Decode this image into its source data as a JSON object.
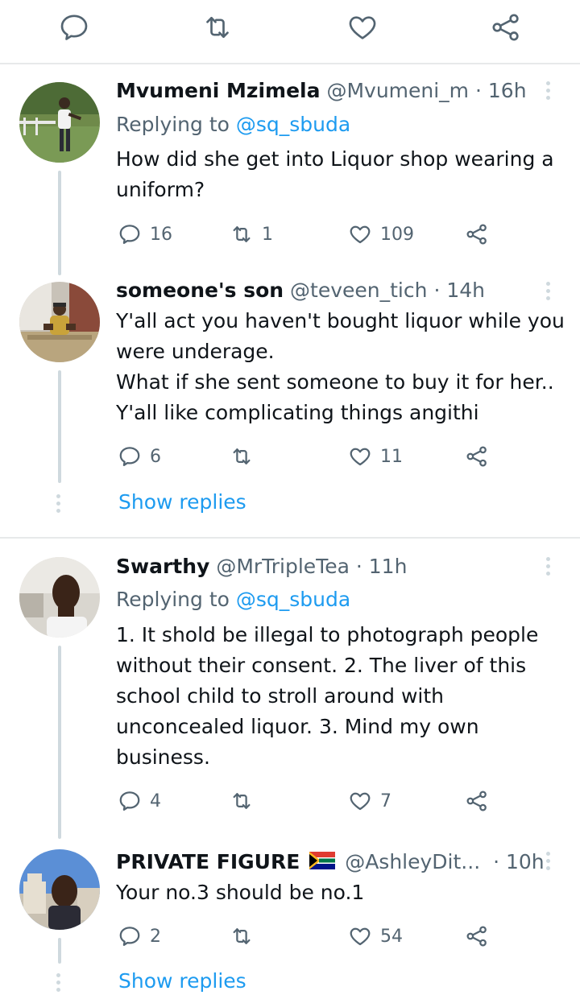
{
  "tweets": [
    {
      "name": "Mvumeni Mzimela",
      "handle": "@Mvumeni_m",
      "sep": "·",
      "time": "16h",
      "replying_prefix": "Replying to ",
      "replying_to": "@sq_sbuda",
      "lines": [
        "How did she get into Liquor shop wearing a",
        "uniform?"
      ],
      "reply_count": "16",
      "retweet_count": "1",
      "like_count": "109"
    },
    {
      "name": "someone's son",
      "handle": "@teveen_tich",
      "sep": "·",
      "time": "14h",
      "lines": [
        "Y'all act you haven't bought liquor while you",
        "were underage.",
        "What if she sent someone to buy it for her..",
        "Y'all like complicating things angithi"
      ],
      "reply_count": "6",
      "retweet_count": "",
      "like_count": "11",
      "show_replies": "Show replies"
    },
    {
      "name": "Swarthy",
      "handle": "@MrTripleTea",
      "sep": "·",
      "time": "11h",
      "replying_prefix": "Replying to ",
      "replying_to": "@sq_sbuda",
      "lines": [
        "1. It shold be illegal to photograph people",
        "without their consent. 2. The liver of this",
        "school child to stroll around with",
        "unconcealed liquor. 3. Mind my own",
        "business."
      ],
      "reply_count": "4",
      "retweet_count": "",
      "like_count": "7"
    },
    {
      "name": "PRIVATE FIGURE",
      "handle": "@AshleyDit...",
      "sep": "·",
      "time": "10h",
      "lines": [
        "Your no.3 should be no.1"
      ],
      "reply_count": "2",
      "retweet_count": "",
      "like_count": "54",
      "show_replies": "Show replies"
    }
  ],
  "colors": {
    "text": "#0f1419",
    "secondary": "#536471",
    "link": "#1d9bf0",
    "divider": "#e7e9ea",
    "thread": "#cfd9de"
  }
}
